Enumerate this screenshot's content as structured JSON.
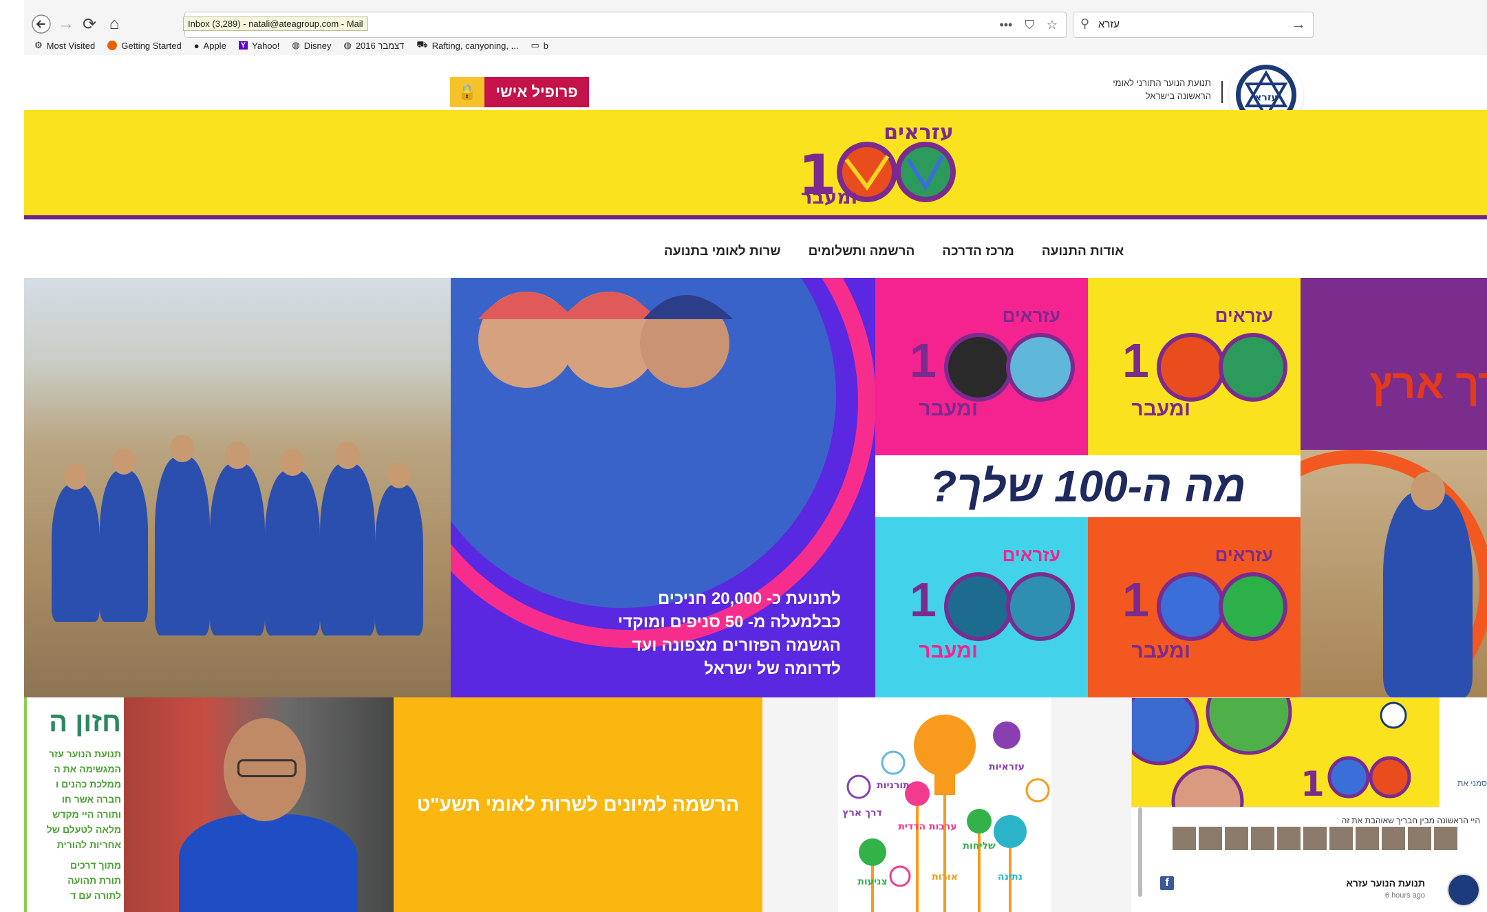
{
  "browser": {
    "tab_tooltip": "Inbox (3,289) - natali@ateagroup.com - Mail",
    "search_query": "עזרא",
    "bookmarks": [
      {
        "label": "Most Visited",
        "icon": "gear-icon"
      },
      {
        "label": "Getting Started",
        "icon": "firefox-icon"
      },
      {
        "label": "Apple",
        "icon": "apple-icon"
      },
      {
        "label": "Yahoo!",
        "icon": "yahoo-icon"
      },
      {
        "label": "Disney",
        "icon": "globe-icon"
      },
      {
        "label": "2016 דצמבר",
        "icon": "globe-icon"
      },
      {
        "label": "Rafting, canyoning, ...",
        "icon": "car-icon"
      },
      {
        "label": "b",
        "icon": "folder-icon"
      }
    ]
  },
  "header": {
    "profile_label": "פרופיל אישי",
    "org_tagline_1": "תנועת הנוער התורני לאומי",
    "org_tagline_2": "הראשונה בישראל",
    "logo_word": "עזרא",
    "campaign_word_top": "עזראים",
    "campaign_word_bottom": "ומעבר"
  },
  "nav": {
    "items": [
      "אודות התנועה",
      "מרכז הדרכה",
      "הרשמה ותשלומים",
      "שרות לאומי בתנועה"
    ]
  },
  "hero": {
    "caption_lines": [
      "לתנועת כ- 20,000 חניכים",
      "כבלמעלה מ- 50 סניפים ומוקדי",
      "הגשמה הפזורים מצפונה ועד",
      "לדרומה של ישראל"
    ],
    "grid_headline": "מה ה-100 שלך?",
    "photo3_text": "בדרך ארץ"
  },
  "lower": {
    "vision_title": "חזון ה",
    "vision_lines": [
      "תנועת הנוער עזר",
      "המגשימה את ה",
      "ממלכת כהנים ו",
      "חברה אשר חו",
      "ותורה היי מקדש",
      "מלאה לטעלם של",
      "אחריות להורית",
      "מתוך דרכים",
      "תורת תהועה",
      "לתורה עם ד"
    ],
    "register_text": "הרשמה למיונים לשרות לאומי תשע\"ט",
    "lights_labels": [
      "עזראיות",
      "תורניות",
      "דרך ארץ",
      "ערבות הדדית",
      "שליחות",
      "צניעות",
      "אורות",
      "נתינה"
    ],
    "fb_like": "סמני את",
    "fb_text": "היי הראשונה מבין חבריך שאוהבת את זה",
    "fb_post_name": "תנועת הנוער עזרא",
    "fb_post_time": "6 hours ago"
  }
}
